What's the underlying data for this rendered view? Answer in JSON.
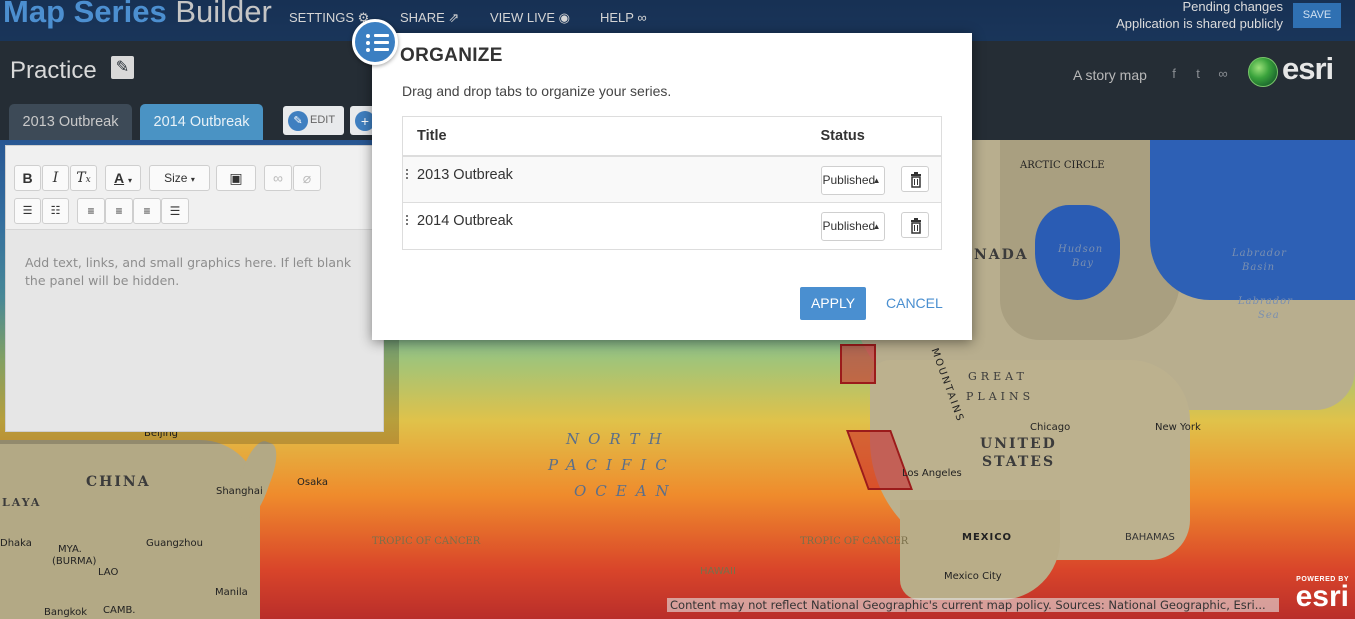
{
  "app": {
    "name_bold": "Map Series",
    "name_light": " Builder",
    "nav": [
      "SETTINGS",
      "SHARE",
      "VIEW LIVE",
      "HELP"
    ],
    "pending_line1": "Pending changes",
    "pending_line2": "Application is shared publicly",
    "save_label": "SAVE"
  },
  "header": {
    "title": "Practice",
    "tagline": "A story map",
    "logo_text": "esri",
    "tabs": [
      "2013 Outbreak",
      "2014 Outbreak"
    ],
    "edit_label": "EDIT"
  },
  "editor": {
    "size_label": "Size",
    "placeholder": "Add text, links, and small graphics here. If left blank the panel will be hidden."
  },
  "dialog": {
    "title": "ORGANIZE",
    "instructions": "Drag and drop tabs to organize your series.",
    "columns": [
      "Title",
      "Status"
    ],
    "rows": [
      {
        "title": "2013 Outbreak",
        "status": "Published"
      },
      {
        "title": "2014 Outbreak",
        "status": "Published"
      }
    ],
    "apply_label": "APPLY",
    "cancel_label": "CANCEL"
  },
  "map": {
    "labels": {
      "china": "CHINA",
      "north": "NORTH",
      "pacific": "PACIFIC",
      "ocean": "OCEAN",
      "great": "GREAT",
      "plains": "PLAINS",
      "united": "UNITED",
      "states": "STATES",
      "nada": "NADA",
      "mountains": "MOUNTAINS",
      "arctic_circle": "ARCTIC CIRCLE",
      "hudson": "Hudson",
      "bay": "Bay",
      "labrador": "Labrador",
      "basin": "Basin",
      "labrador2": "Labrador",
      "sea": "Sea",
      "chicago": "Chicago",
      "new_york": "New York",
      "los_angeles": "Los Angeles",
      "mexico": "MEXICO",
      "mexico_city": "Mexico City",
      "bahamas": "BAHAMAS",
      "tropic_left": "TROPIC OF CANCER",
      "tropic_right": "TROPIC OF CANCER",
      "osaka": "Osaka",
      "shanghai": "Shanghai",
      "guangzhou": "Guangzhou",
      "manila": "Manila",
      "bangkok": "Bangkok",
      "laya": "LAYA",
      "dhaka": "Dhaka",
      "mya": "MYA.",
      "burma": "(BURMA)",
      "lao": "LAO",
      "cam": "CAMB.",
      "beijing": "Beijing",
      "hawaii": "HAWAII"
    },
    "attribution": "Content may not reflect National Geographic's current map policy. Sources: National Geographic, Esri...",
    "powered_small": "POWERED BY",
    "powered_big": "esri"
  }
}
